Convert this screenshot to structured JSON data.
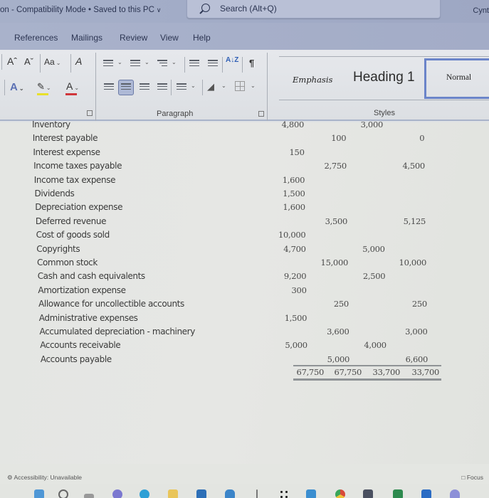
{
  "titlebar": {
    "document_title": "on  -  Compatibility Mode • Saved to this PC",
    "chevron": "∨",
    "search_placeholder": "Search (Alt+Q)",
    "user_name": "Cynt"
  },
  "menu": {
    "tabs": [
      "References",
      "Mailings",
      "Review",
      "View",
      "Help"
    ]
  },
  "ribbon": {
    "font_group": {
      "grow_font": "Aˆ",
      "shrink_font": "Aˇ",
      "change_case": "Aa",
      "clear_formatting": "A",
      "text_effects": "A",
      "highlight": "✎",
      "font_color": "A",
      "highlight_color": "#e8e02a",
      "font_color_value": "#d0363b"
    },
    "paragraph_group": {
      "label": "Paragraph",
      "sort": "A↓Z",
      "show_marks": "¶"
    },
    "styles_group": {
      "label": "Styles",
      "items": [
        "Emphasis",
        "Heading 1",
        "Normal"
      ],
      "selected": "Normal"
    },
    "dropdown_arrow": "⌄",
    "launcher": "↘"
  },
  "document": {
    "accounts": [
      {
        "name": "Inventory",
        "debit1": "4,800",
        "credit1": "",
        "debit2": "3,000",
        "credit2": ""
      },
      {
        "name": "Interest payable",
        "debit1": "",
        "credit1": "100",
        "debit2": "",
        "credit2": "0"
      },
      {
        "name": "Interest expense",
        "debit1": "150",
        "credit1": "",
        "debit2": "",
        "credit2": ""
      },
      {
        "name": "Income taxes payable",
        "debit1": "",
        "credit1": "2,750",
        "debit2": "",
        "credit2": "4,500"
      },
      {
        "name": "Income tax expense",
        "debit1": "1,600",
        "credit1": "",
        "debit2": "",
        "credit2": ""
      },
      {
        "name": "Dividends",
        "debit1": "1,500",
        "credit1": "",
        "debit2": "",
        "credit2": ""
      },
      {
        "name": "Depreciation expense",
        "debit1": "1,600",
        "credit1": "",
        "debit2": "",
        "credit2": ""
      },
      {
        "name": "Deferred revenue",
        "debit1": "",
        "credit1": "3,500",
        "debit2": "",
        "credit2": "5,125"
      },
      {
        "name": "Cost of goods sold",
        "debit1": "10,000",
        "credit1": "",
        "debit2": "",
        "credit2": ""
      },
      {
        "name": "Copyrights",
        "debit1": "4,700",
        "credit1": "",
        "debit2": "5,000",
        "credit2": ""
      },
      {
        "name": "Common stock",
        "debit1": "",
        "credit1": "15,000",
        "debit2": "",
        "credit2": "10,000"
      },
      {
        "name": "Cash and cash equivalents",
        "debit1": "9,200",
        "credit1": "",
        "debit2": "2,500",
        "credit2": ""
      },
      {
        "name": "Amortization expense",
        "debit1": "300",
        "credit1": "",
        "debit2": "",
        "credit2": ""
      },
      {
        "name": "Allowance for uncollectible accounts",
        "debit1": "",
        "credit1": "250",
        "debit2": "",
        "credit2": "250"
      },
      {
        "name": "Administrative expenses",
        "debit1": "1,500",
        "credit1": "",
        "debit2": "",
        "credit2": ""
      },
      {
        "name": "Accumulated depreciation - machinery",
        "debit1": "",
        "credit1": "3,600",
        "debit2": "",
        "credit2": "3,000"
      },
      {
        "name": "Accounts receivable",
        "debit1": "5,000",
        "credit1": "",
        "debit2": "4,000",
        "credit2": ""
      },
      {
        "name": "Accounts payable",
        "debit1": "",
        "credit1": "5,000",
        "debit2": "",
        "credit2": "6,600"
      }
    ],
    "totals": {
      "debit1": "67,750",
      "credit1": "67,750",
      "debit2": "33,700",
      "credit2": "33,700"
    }
  },
  "statusbar": {
    "accessibility": "Accessibility: Unavailable",
    "focus": "Focus"
  },
  "taskbar": {
    "icons": [
      "windows-start-icon",
      "search-icon",
      "task-view-icon",
      "teams-icon",
      "edge-icon",
      "file-explorer-icon",
      "store-icon",
      "mail-icon",
      "app-icon",
      "app-grid-icon",
      "camera-icon",
      "chrome-icon",
      "app-icon",
      "excel-icon",
      "word-icon",
      "discord-icon"
    ]
  }
}
